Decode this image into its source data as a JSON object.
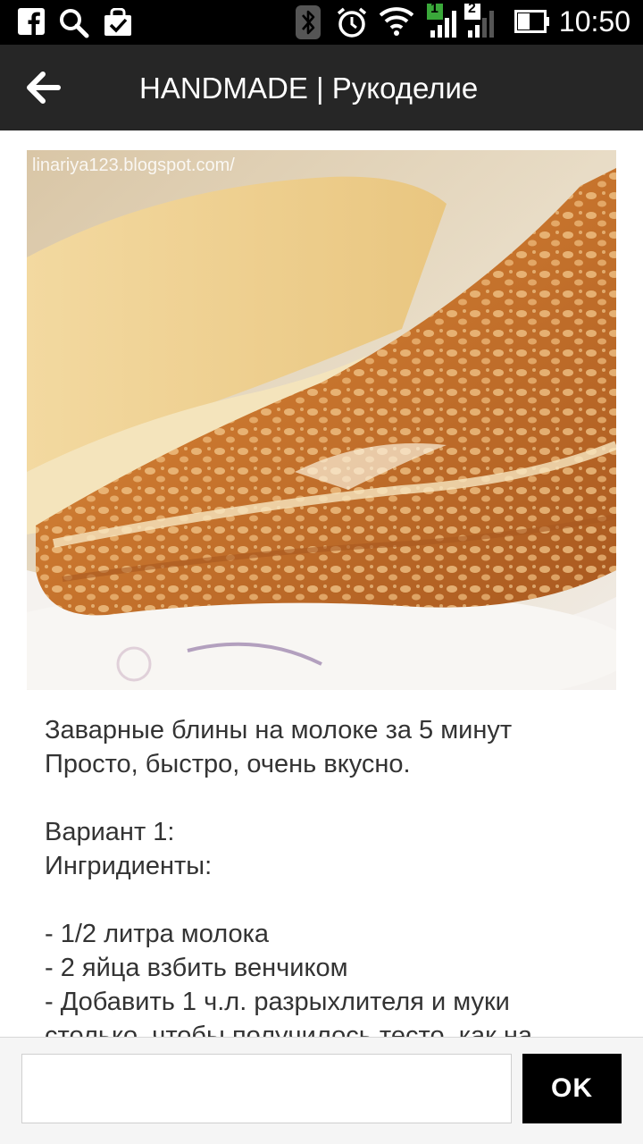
{
  "status_bar": {
    "time": "10:50",
    "sim1": "1",
    "sim2": "2",
    "icons": [
      "facebook-icon",
      "search-icon",
      "shopping-bag-icon",
      "bluetooth-icon",
      "alarm-icon",
      "wifi-icon",
      "signal-icon",
      "battery-icon"
    ]
  },
  "app_bar": {
    "title": "HANDMADE | Рукоделие",
    "back_icon": "arrow-left-icon"
  },
  "post": {
    "image_watermark": "linariya123.blogspot.com/",
    "lines": [
      "Заварные блины на молоке за 5 минут",
      "Просто, быстро, очень вкусно.",
      "",
      "Вариант 1:",
      "Ингридиенты:",
      "",
      "- 1/2 литра молока",
      "- 2 яйца взбить венчиком",
      "- Добавить 1 ч.л. разрыхлителя и муки",
      "столько, чтобы получилось тесто, как на"
    ]
  },
  "comment_bar": {
    "input_value": "",
    "input_placeholder": "",
    "ok_label": "OK"
  },
  "colors": {
    "status_bar": "#000000",
    "app_bar": "#262626",
    "text": "#333333",
    "button": "#000000"
  }
}
